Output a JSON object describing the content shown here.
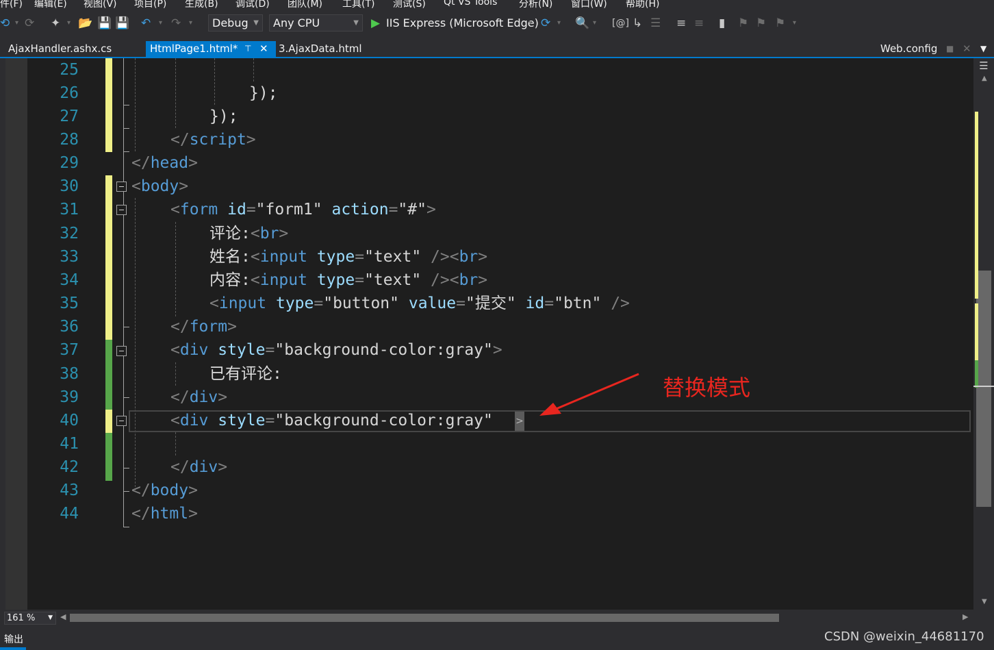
{
  "menu": [
    "件(F)",
    "编辑(E)",
    "视图(V)",
    "项目(P)",
    "生成(B)",
    "调试(D)",
    "团队(M)",
    "工具(T)",
    "测试(S)",
    "Qt VS Tools",
    "分析(N)",
    "窗口(W)",
    "帮助(H)"
  ],
  "toolbar": {
    "config": "Debug",
    "platform": "Any CPU",
    "run_label": "IIS Express (Microsoft Edge)"
  },
  "tabs": {
    "left": "AjaxHandler.ashx.cs",
    "active": "HtmlPage1.html*",
    "third": "3.AjaxData.html",
    "right": "Web.config"
  },
  "lines": [
    "25",
    "26",
    "27",
    "28",
    "29",
    "30",
    "31",
    "32",
    "33",
    "34",
    "35",
    "36",
    "37",
    "38",
    "39",
    "40",
    "41",
    "42",
    "43",
    "44"
  ],
  "code": {
    "l26": "});",
    "l27": "});",
    "l28_tag": "script",
    "l29_tag": "head",
    "l30_tag": "body",
    "l31_tag": "form",
    "l31_attr1": "id",
    "l31_val1": "\"form1\"",
    "l31_attr2": "action",
    "l31_val2": "\"#\"",
    "l32_text": "评论:",
    "br": "br",
    "l33_text": "姓名:",
    "input": "input",
    "type": "type",
    "text_val": "\"text\"",
    "l34_text": "内容:",
    "l35_type_val": "\"button\"",
    "value_attr": "value",
    "l35_value_val": "\"提交\"",
    "id_attr": "id",
    "l35_id_val": "\"btn\"",
    "l36_tag": "form",
    "div": "div",
    "style_attr": "style",
    "style_val": "\"background-color:gray\"",
    "l38_text": "已有评论:",
    "l43_tag": "body",
    "l44_tag": "html"
  },
  "annotation": "替换模式",
  "zoom": "161 %",
  "status": {
    "left": "输出",
    "watermark": "CSDN @weixin_44681170"
  },
  "colors": {
    "accent": "#007acc",
    "tag": "#569cd6",
    "attr": "#9cdcfe",
    "line_number": "#2b91af",
    "annotation": "#e8261f",
    "change_saved": "#57a64a",
    "change_unsaved": "#efef88"
  }
}
